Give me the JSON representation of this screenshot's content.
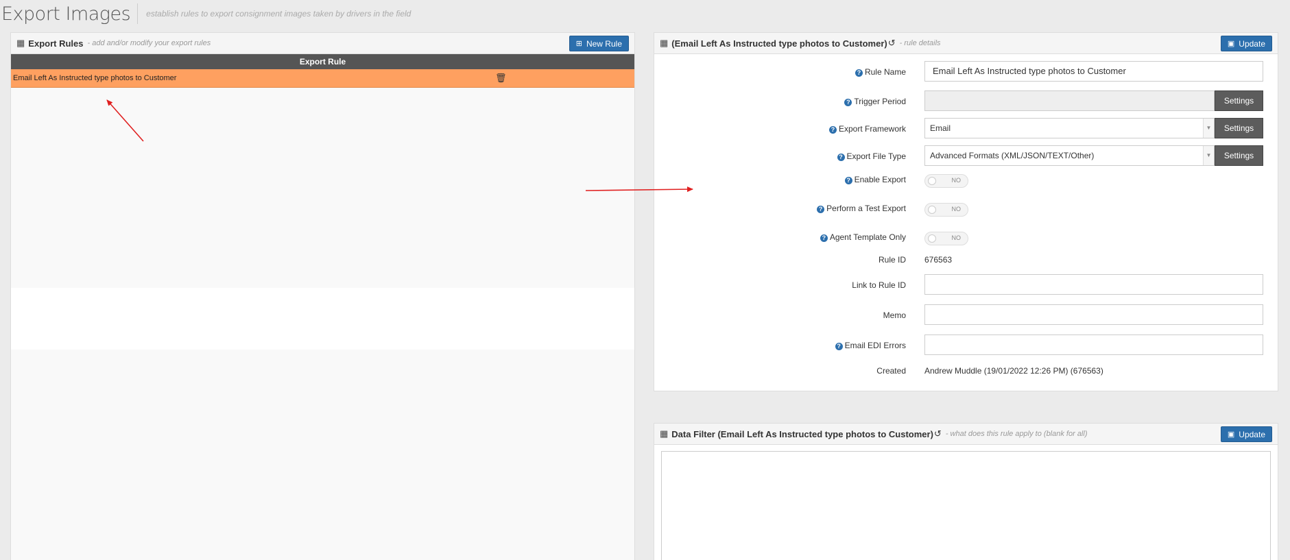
{
  "header": {
    "title": "Export Images",
    "subtitle": "establish rules to export consignment images taken by drivers in the field"
  },
  "rules_panel": {
    "title": "Export Rules",
    "subtitle": "- add and/or modify your export rules",
    "new_button": "New Rule",
    "column_header": "Export Rule",
    "rows": [
      {
        "name": "Email Left As Instructed type photos to Customer"
      }
    ]
  },
  "details_panel": {
    "title": "(Email Left As Instructed type photos to Customer)",
    "subtitle": "- rule details",
    "update_button": "Update",
    "fields": {
      "rule_name": {
        "label": "Rule Name",
        "value": "Email Left As Instructed type photos to Customer"
      },
      "trigger_period": {
        "label": "Trigger Period",
        "value": "",
        "button": "Settings"
      },
      "export_framework": {
        "label": "Export Framework",
        "value": "Email",
        "button": "Settings"
      },
      "export_file_type": {
        "label": "Export File Type",
        "value": "Advanced Formats (XML/JSON/TEXT/Other)",
        "button": "Settings"
      },
      "enable_export": {
        "label": "Enable Export",
        "state": "NO"
      },
      "test_export": {
        "label": "Perform a Test Export",
        "state": "NO"
      },
      "agent_template": {
        "label": "Agent Template Only",
        "state": "NO"
      },
      "rule_id": {
        "label": "Rule ID",
        "value": "676563"
      },
      "link_rule_id": {
        "label": "Link to Rule ID",
        "value": ""
      },
      "memo": {
        "label": "Memo",
        "value": ""
      },
      "email_edi_errors": {
        "label": "Email EDI Errors",
        "value": ""
      },
      "created": {
        "label": "Created",
        "value": "Andrew Muddle (19/01/2022 12:26 PM) (676563)"
      }
    }
  },
  "filter_panel": {
    "title": "Data Filter (Email Left As Instructed type photos to Customer)",
    "subtitle": "- what does this rule apply to (blank for all)",
    "update_button": "Update"
  },
  "icons": {
    "grid": "table-grid-icon",
    "history": "history-icon",
    "plus": "plus-square-icon",
    "save": "floppy-disk-icon",
    "trash": "trash-icon",
    "help": "question-circle-icon"
  },
  "colors": {
    "accent_blue": "#2c6fad",
    "selected_row": "#fea060",
    "table_header": "#555555",
    "annotation_arrow": "#e02020"
  }
}
